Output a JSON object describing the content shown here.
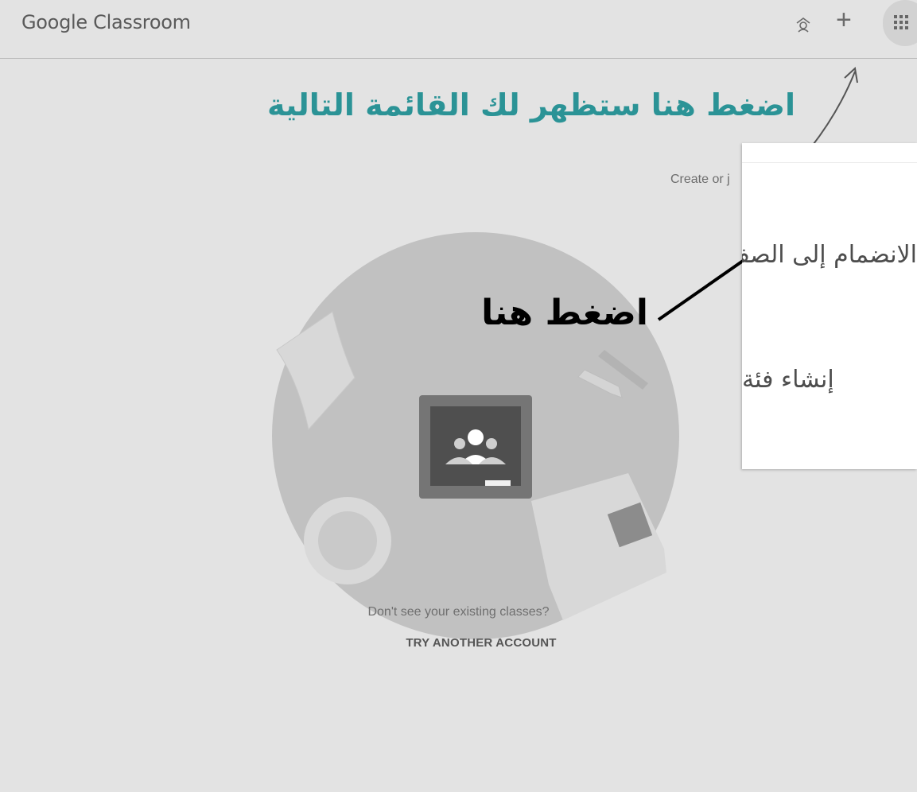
{
  "header": {
    "app_title": "Google Classroom",
    "icons": [
      "teacher-icon",
      "add-icon",
      "apps-grid-icon"
    ]
  },
  "annotations": {
    "top_instruction": "اضغط هنا ستظهر لك القائمة التالية",
    "click_here": "اضغط هنا"
  },
  "main": {
    "create_or_join": "Create or j",
    "hint_text": "Don't see your existing classes?",
    "try_another_account": "TRY ANOTHER ACCOUNT"
  },
  "popup_menu": {
    "items": [
      {
        "label": "الانضمام إلى الصف"
      },
      {
        "label": "إنشاء فئة"
      }
    ]
  },
  "colors": {
    "annotation_teal": "#2b9396",
    "background": "#e3e3e3",
    "popup_bg": "#ffffff"
  }
}
